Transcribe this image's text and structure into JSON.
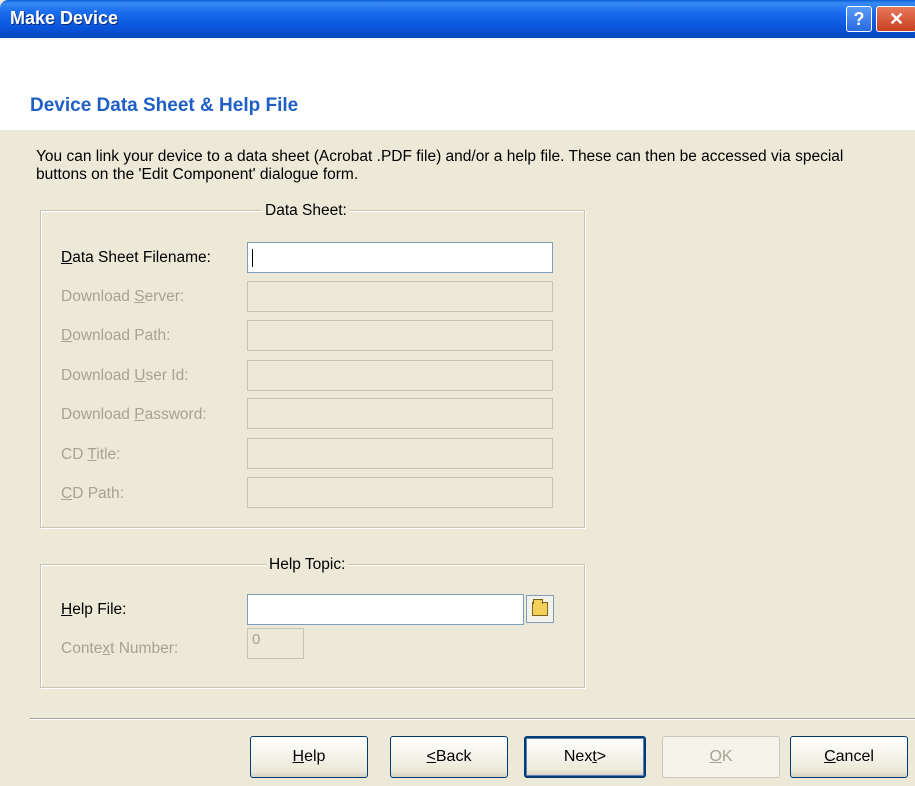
{
  "window": {
    "title": "Make Device",
    "help_glyph": "?",
    "close_glyph": "✕"
  },
  "page": {
    "title": "Device Data Sheet & Help File",
    "intro": "You can link your device to a data sheet (Acrobat .PDF file) and/or a help file. These can then be accessed via special buttons on the 'Edit Component' dialogue form."
  },
  "datasheet": {
    "legend": "Data Sheet:",
    "rows": [
      {
        "label": "Data Sheet Filename:",
        "value": "",
        "enabled": true
      },
      {
        "label": "Download Server:",
        "value": "",
        "enabled": false
      },
      {
        "label": "Download Path:",
        "value": "",
        "enabled": false
      },
      {
        "label": "Download User Id:",
        "value": "",
        "enabled": false
      },
      {
        "label": "Download Password:",
        "value": "",
        "enabled": false
      },
      {
        "label": "CD Title:",
        "value": "",
        "enabled": false
      },
      {
        "label": "CD Path:",
        "value": "",
        "enabled": false
      }
    ]
  },
  "helptopic": {
    "legend": "Help Topic:",
    "help_file_label": "Help File:",
    "help_file_value": "",
    "context_label": "Context Number:",
    "context_value": "0"
  },
  "buttons": {
    "help": "Help",
    "back": "<Back",
    "next": "Next>",
    "ok": "OK",
    "cancel": "Cancel"
  }
}
